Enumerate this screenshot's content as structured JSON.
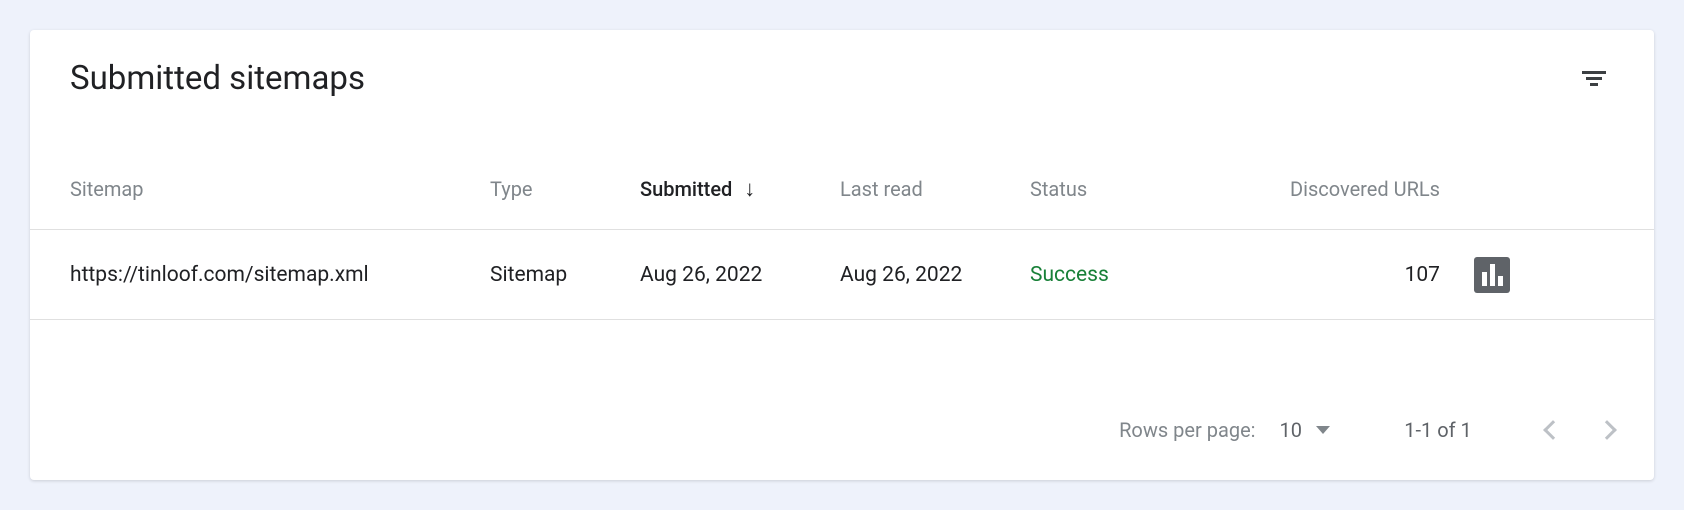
{
  "header": {
    "title": "Submitted sitemaps"
  },
  "table": {
    "columns": {
      "sitemap": "Sitemap",
      "type": "Type",
      "submitted": "Submitted",
      "last_read": "Last read",
      "status": "Status",
      "discovered_urls": "Discovered URLs"
    },
    "sort": {
      "column": "submitted",
      "direction": "desc"
    },
    "rows": [
      {
        "sitemap": "https://tinloof.com/sitemap.xml",
        "type": "Sitemap",
        "submitted": "Aug 26, 2022",
        "last_read": "Aug 26, 2022",
        "status": "Success",
        "discovered_urls": "107"
      }
    ]
  },
  "pagination": {
    "rows_per_page_label": "Rows per page:",
    "rows_per_page_value": "10",
    "range": "1-1 of 1"
  }
}
